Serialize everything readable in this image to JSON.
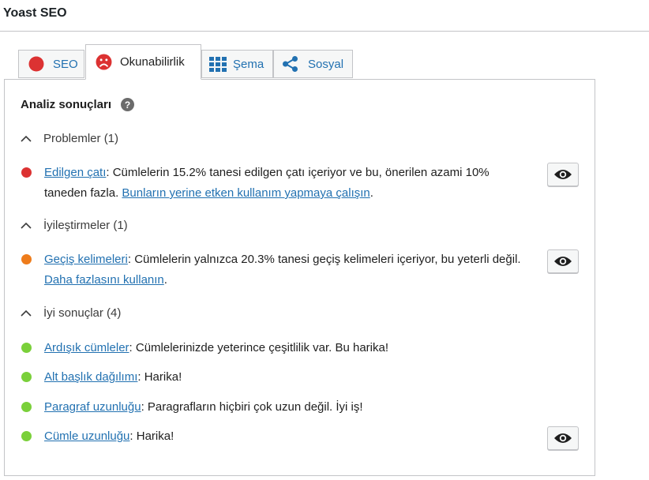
{
  "header": {
    "title": "Yoast SEO"
  },
  "tabs": [
    {
      "label": "SEO"
    },
    {
      "label": "Okunabilirlik"
    },
    {
      "label": "Şema"
    },
    {
      "label": "Sosyal"
    }
  ],
  "panel": {
    "title": "Analiz sonuçları",
    "help": "?"
  },
  "groups": {
    "problems": {
      "label": "Problemler (1)"
    },
    "improvements": {
      "label": "İyileştirmeler (1)"
    },
    "good": {
      "label": "İyi sonuçlar (4)"
    }
  },
  "results": {
    "passive": {
      "link": "Edilgen çatı",
      "text": ": Cümlelerin 15.2% tanesi edilgen çatı içeriyor ve bu, önerilen azami 10% taneden fazla. ",
      "link2": "Bunların yerine etken kullanım yapmaya çalışın",
      "end": "."
    },
    "transition": {
      "link": "Geçiş kelimeleri",
      "text": ": Cümlelerin yalnızca 20.3% tanesi geçiş kelimeleri içeriyor, bu yeterli değil. ",
      "link2": "Daha fazlasını kullanın",
      "end": "."
    },
    "consecutive": {
      "link": "Ardışık cümleler",
      "text": ": Cümlelerinizde yeterince çeşitlilik var. Bu harika!"
    },
    "subheading": {
      "link": "Alt başlık dağılımı",
      "text": ": Harika!"
    },
    "paragraph": {
      "link": "Paragraf uzunluğu",
      "text": ": Paragrafların hiçbiri çok uzun değil. İyi iş!"
    },
    "sentence": {
      "link": "Cümle uzunluğu",
      "text": ": Harika!"
    }
  },
  "colors": {
    "bad": "#dc3232",
    "ok": "#ee7c1b",
    "good": "#7ad03a",
    "link": "#2271b1",
    "sad_face": "#dc3232",
    "tab_icon": "#2271b1"
  },
  "icons": {
    "seo": "red-circle-icon",
    "readability": "sad-face-icon",
    "schema": "grid-icon",
    "social": "share-icon",
    "eye": "eye-icon",
    "chevron": "chevron-up-icon"
  }
}
